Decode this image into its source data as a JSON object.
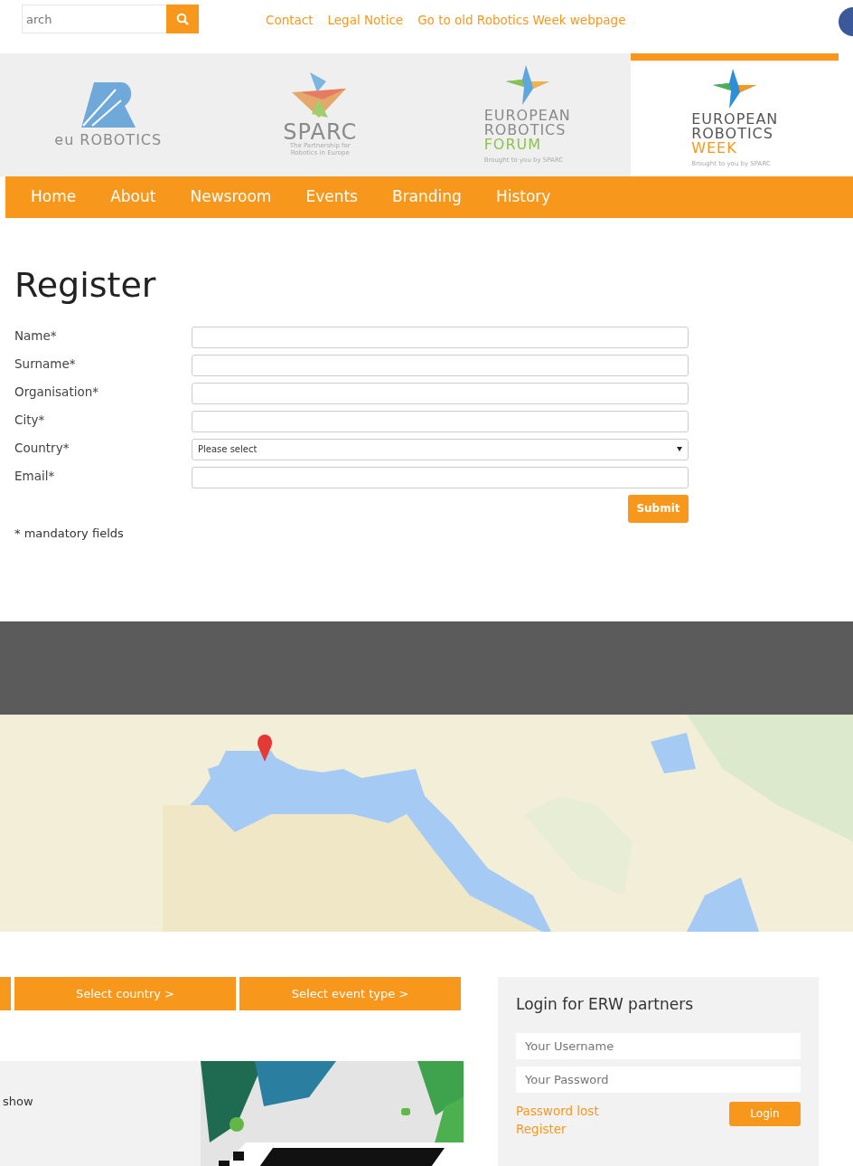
{
  "search": {
    "placeholder": "arch"
  },
  "top_links": [
    "Contact",
    "Legal Notice",
    "Go to old Robotics Week webpage"
  ],
  "logos": [
    {
      "kind": "eurobotics",
      "lines": [
        "eu ROBOTICS"
      ],
      "selected": false
    },
    {
      "kind": "sparc",
      "lines": [
        "SPARC",
        "The Partnership for",
        "Robotics in Europe"
      ],
      "selected": false
    },
    {
      "kind": "forum",
      "lines": [
        "EUROPEAN",
        "ROBOTICS",
        "FORUM",
        "Brought to you by SPARC"
      ],
      "selected": false
    },
    {
      "kind": "week",
      "lines": [
        "EUROPEAN",
        "ROBOTICS",
        "WEEK",
        "Brought to you by SPARC"
      ],
      "selected": true
    }
  ],
  "nav": [
    "Home",
    "About",
    "Newsroom",
    "Events",
    "Branding",
    "History"
  ],
  "page_title": "Register",
  "form": {
    "fields": [
      {
        "label": "Name*",
        "kind": "text"
      },
      {
        "label": "Surname*",
        "kind": "text"
      },
      {
        "label": "Organisation*",
        "kind": "text"
      },
      {
        "label": "City*",
        "kind": "text"
      },
      {
        "label": "Country*",
        "kind": "select",
        "value": "Please select"
      },
      {
        "label": "Email*",
        "kind": "text"
      }
    ],
    "submit": "Submit",
    "note": "* mandatory fields"
  },
  "map": {
    "kind": "picture"
  },
  "filters": [
    "Select country >",
    "Select event type >"
  ],
  "event_text": "show",
  "login": {
    "title": "Login for ERW partners",
    "username_placeholder": "Your Username",
    "password_placeholder": "Your Password",
    "links": [
      "Password lost",
      "Register"
    ],
    "button": "Login"
  }
}
